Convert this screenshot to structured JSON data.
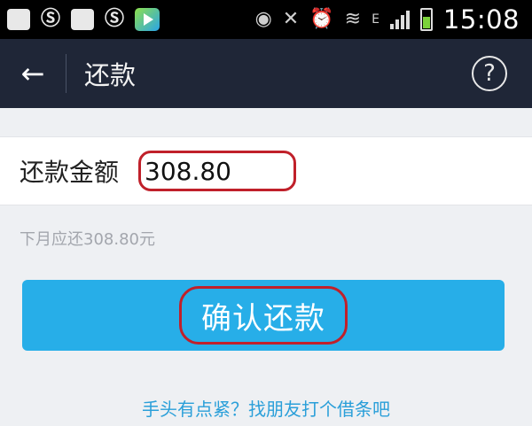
{
  "status_bar": {
    "time": "15:08",
    "network_label": "E",
    "icons": [
      "add-box-icon",
      "netease-music-icon",
      "image-icon",
      "netease-music-icon",
      "video-player-icon",
      "eye-icon",
      "mute-icon",
      "alarm-icon",
      "wifi-icon",
      "signal-icon",
      "battery-icon"
    ]
  },
  "nav": {
    "back_glyph": "←",
    "title": "还款",
    "help_glyph": "?"
  },
  "form": {
    "amount_label": "还款金额",
    "amount_value": "308.80",
    "hint": "下月应还308.80元"
  },
  "confirm_button": {
    "label": "确认还款"
  },
  "borrow_link": {
    "label": "手头有点紧？找朋友打个借条吧"
  },
  "colors": {
    "nav_bg": "#1f2637",
    "button_bg": "#27aee8",
    "highlight_red": "#c0202a",
    "link_blue": "#2a9fd9"
  }
}
